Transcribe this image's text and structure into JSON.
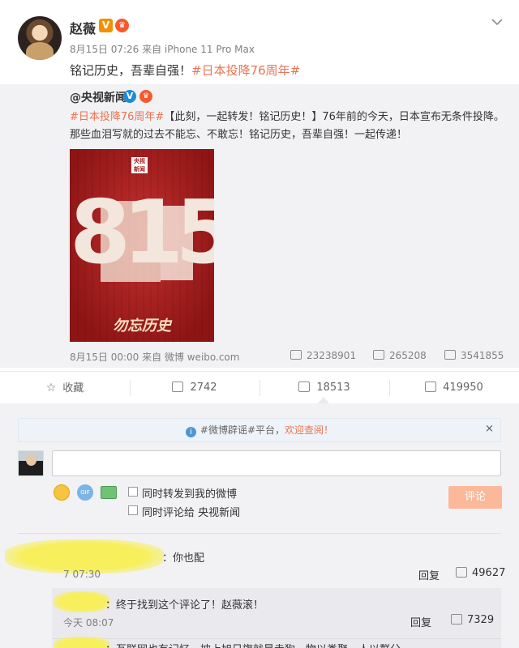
{
  "post": {
    "author": "赵薇",
    "v_badge": "V",
    "vip_badge": "♛",
    "meta": "8月15日 07:26 来自 iPhone 11 Pro Max",
    "text": "铭记历史，吾辈自强！",
    "hashtag": "#日本投降76周年#",
    "expand_icon": "chevron-down-icon"
  },
  "repost": {
    "author": "@央视新闻",
    "v_badge": "V",
    "vip_badge": "♛",
    "hashtag": "#日本投降76周年#",
    "text": "【此刻，一起转发！铭记历史！】76年前的今天，日本宣布无条件投降。那些血泪写就的过去不能忘、不敢忘！铭记历史，吾辈自强！一起传递！",
    "image": {
      "logo": "央视新闻",
      "number": "815",
      "slogan": "勿忘历史"
    },
    "footer": "8月15日 00:00 来自 微博 weibo.com",
    "stats": {
      "reposts": "23238901",
      "comments": "265208",
      "likes": "3541855"
    }
  },
  "actions": {
    "favorite": "收藏",
    "repost": "2742",
    "comment": "18513",
    "like": "419950"
  },
  "notice": {
    "prefix": "#微博辟谣#平台，",
    "link": "欢迎查阅！",
    "close": "×"
  },
  "composer": {
    "placeholder": "",
    "option_repost": "同时转发到我的微博",
    "option_comment": "同时评论给 央视新闻",
    "submit": "评论"
  },
  "comments": [
    {
      "text": "：你也配",
      "time": "7 07:30",
      "reply": "回复",
      "likes": "49627"
    },
    {
      "text": "：终于找到这个评论了！赵薇滚！",
      "time": "今天 08:07",
      "reply": "回复",
      "likes": "7329"
    },
    {
      "text": "：互联网也有记忆，披上旭日旗就是走狗，物以类聚，人以群分"
    }
  ],
  "colors": {
    "accent": "#eb7350",
    "link_blue": "#4e96d3",
    "submit_disabled": "#fbb99a"
  }
}
